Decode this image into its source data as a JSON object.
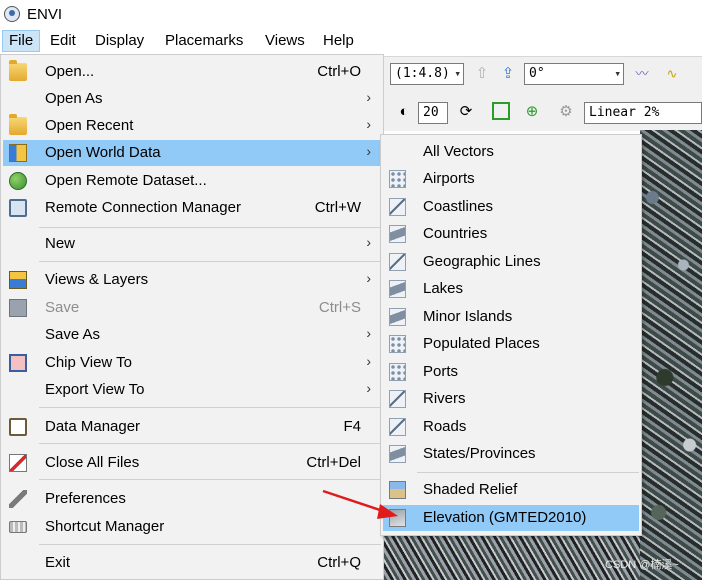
{
  "window": {
    "title": "ENVI"
  },
  "menubar": {
    "items": [
      "File",
      "Edit",
      "Display",
      "Placemarks",
      "Views",
      "Help"
    ]
  },
  "toolbar": {
    "scale_value": "(1:4.8)",
    "rotation_value": "0°",
    "brightness_value": "20",
    "stretch_value": "Linear 2%"
  },
  "file_menu": {
    "items": [
      {
        "label": "Open...",
        "shortcut": "Ctrl+O",
        "icon": "open-folder-icon"
      },
      {
        "label": "Open As",
        "arrow": "›"
      },
      {
        "label": "Open Recent",
        "arrow": "›",
        "icon": "recent-icon"
      },
      {
        "label": "Open World Data",
        "arrow": "›",
        "icon": "world-data-icon"
      },
      {
        "label": "Open Remote Dataset...",
        "icon": "remote-dataset-icon"
      },
      {
        "label": "Remote Connection Manager",
        "shortcut": "Ctrl+W",
        "icon": "remote-connection-icon"
      },
      {
        "label": "New",
        "arrow": "›"
      },
      {
        "label": "Views & Layers",
        "arrow": "›",
        "icon": "views-layers-icon"
      },
      {
        "label": "Save",
        "shortcut": "Ctrl+S",
        "icon": "save-icon"
      },
      {
        "label": "Save As",
        "arrow": "›"
      },
      {
        "label": "Chip View To",
        "arrow": "›",
        "icon": "chip-icon"
      },
      {
        "label": "Export View To",
        "arrow": "›"
      },
      {
        "label": "Data Manager",
        "shortcut": "F4",
        "icon": "data-manager-icon"
      },
      {
        "label": "Close All Files",
        "shortcut": "Ctrl+Del",
        "icon": "close-files-icon"
      },
      {
        "label": "Preferences",
        "icon": "wrench-icon"
      },
      {
        "label": "Shortcut Manager",
        "icon": "keyboard-icon"
      },
      {
        "label": "Exit",
        "shortcut": "Ctrl+Q"
      }
    ]
  },
  "world_data_menu": {
    "items": [
      {
        "label": "All Vectors"
      },
      {
        "label": "Airports",
        "icon": "points-icon"
      },
      {
        "label": "Coastlines",
        "icon": "lines-icon"
      },
      {
        "label": "Countries",
        "icon": "polygon-icon"
      },
      {
        "label": "Geographic Lines",
        "icon": "lines-icon"
      },
      {
        "label": "Lakes",
        "icon": "polygon-icon"
      },
      {
        "label": "Minor Islands",
        "icon": "polygon-icon"
      },
      {
        "label": "Populated Places",
        "icon": "points-icon"
      },
      {
        "label": "Ports",
        "icon": "points-icon"
      },
      {
        "label": "Rivers",
        "icon": "lines-icon"
      },
      {
        "label": "Roads",
        "icon": "lines-icon"
      },
      {
        "label": "States/Provinces",
        "icon": "polygon-icon"
      },
      {
        "label": "Shaded Relief",
        "icon": "shaded-relief-icon"
      },
      {
        "label": "Elevation (GMTED2010)",
        "icon": "elevation-icon"
      }
    ]
  },
  "watermark": "CSDN @楠溪~"
}
